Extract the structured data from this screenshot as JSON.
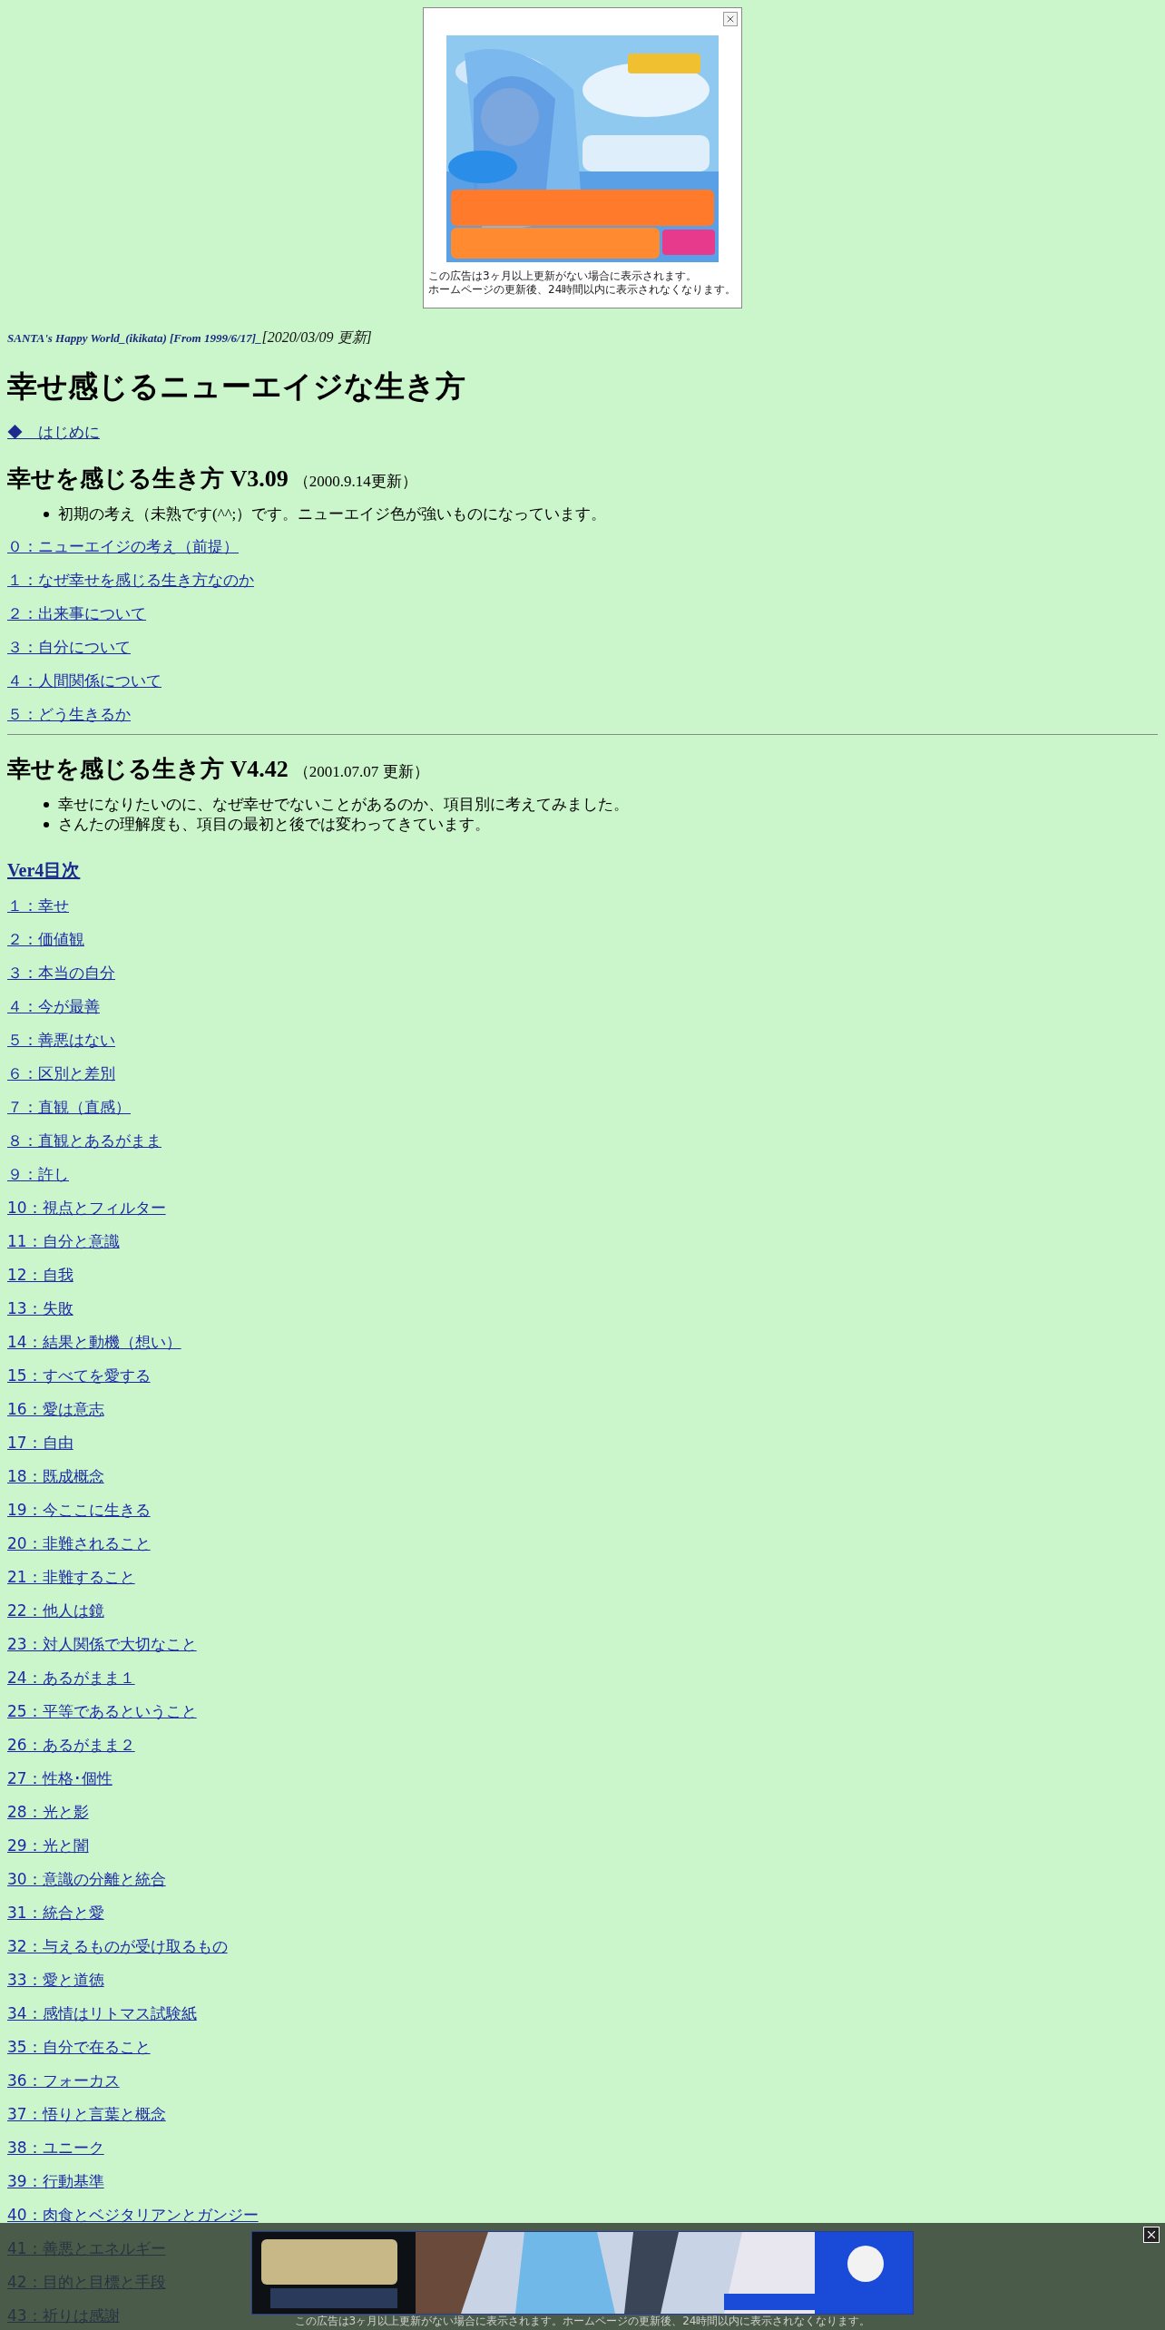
{
  "ad_popup": {
    "caption": [
      "この広告は3ヶ月以上更新がない場合に表示されます。",
      "ホームページの更新後、24時間以内に表示されなくなります。"
    ]
  },
  "header": {
    "site": "SANTA's Happy World_(ikikata) [From 1999/6/17]_",
    "updated": "[2020/03/09 更新]"
  },
  "title": "幸せ感じるニューエイジな生き方",
  "intro_link": "◆　はじめに",
  "sections": [
    {
      "title": "幸せを感じる生き方 V3.09",
      "date": "（2000.9.14更新）",
      "bullets": [
        "初期の考え（未熟です(^^;）です。ニューエイジ色が強いものになっています。"
      ],
      "links": [
        "０：ニューエイジの考え（前提）",
        "１：なぜ幸せを感じる生き方なのか",
        "２：出来事について",
        "３：自分について",
        "４：人間関係について",
        "５：どう生きるか"
      ]
    },
    {
      "title": "幸せを感じる生き方 V4.42",
      "date": "（2001.07.07 更新）",
      "bullets": [
        "幸せになりたいのに、なぜ幸せでないことがあるのか、項目別に考えてみました。",
        "さんたの理解度も、項目の最初と後では変わってきています。"
      ],
      "toc_heading": "Ver4目次",
      "links": [
        "１：幸せ",
        "２：価値観",
        "３：本当の自分",
        "４：今が最善",
        "５：善悪はない",
        "６：区別と差別",
        "７：直観（直感）",
        "８：直観とあるがまま",
        "９：許し",
        "10：視点とフィルター",
        "11：自分と意識",
        "12：自我",
        "13：失敗",
        "14：結果と動機（想い）",
        "15：すべてを愛する",
        "16：愛は意志",
        "17：自由",
        "18：既成概念",
        "19：今ここに生きる",
        "20：非難されること",
        "21：非難すること",
        "22：他人は鏡",
        "23：対人関係で大切なこと",
        "24：あるがまま１",
        "25：平等であるということ",
        "26：あるがまま２",
        "27：性格･個性",
        "28：光と影",
        "29：光と闇",
        "30：意識の分離と統合",
        "31：統合と愛",
        "32：与えるものが受け取るもの",
        "33：愛と道徳",
        "34：感情はリトマス試験紙",
        "35：自分で在ること",
        "36：フォーカス",
        "37：悟りと言葉と概念",
        "38：ユニーク",
        "39：行動基準",
        "40：肉食とベジタリアンとガンジー",
        "41：善悪とエネルギー",
        "42：目的と目標と手段",
        "43：祈りは感謝"
      ]
    }
  ],
  "bottom_ad": {
    "caption": "この広告は3ヶ月以上更新がない場合に表示されます。ホームページの更新後、24時間以内に表示されなくなります。"
  }
}
